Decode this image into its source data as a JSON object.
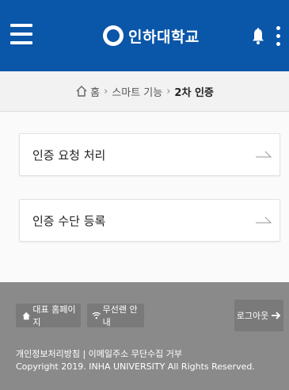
{
  "header": {
    "logo_text": "인하대학교",
    "bg_color": "#0a56a8"
  },
  "breadcrumb": {
    "home": "홈",
    "smart": "스마트 기능",
    "current": "2차 인증",
    "sep": "›"
  },
  "menu": [
    {
      "label": "인증 요청 처리"
    },
    {
      "label": "인증 수단 등록"
    }
  ],
  "footer": {
    "homepage_label": "대표 홈페이지",
    "wifi_label": "무선랜 안내",
    "logout_label": "로그아웃",
    "policy_text": "개인정보처리방침 | 이메일주소 무단수집 거부",
    "copyright": "Copyright 2019. INHA UNIVERSITY All Rights Reserved."
  }
}
